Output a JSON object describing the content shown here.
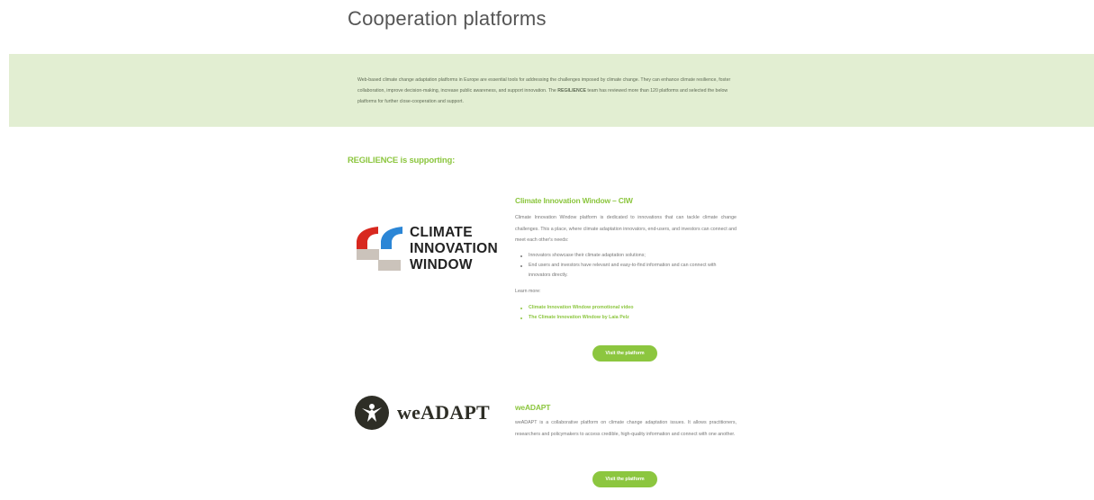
{
  "page": {
    "title": "Cooperation platforms"
  },
  "intro": {
    "text_before": "Web-based climate change adaptation platforms in Europe are essential tools for addressing the challenges imposed by climate change. They can enhance climate resilience, foster collaboration, improve decision-making, increase public awareness, and support innovation. The ",
    "brand": "REGILIENCE",
    "text_after": " team has reviewed more than 120 platforms and selected the below platforms for further close-cooperation and support."
  },
  "supporting_heading": "REGILIENCE is supporting:",
  "platforms": [
    {
      "logo": {
        "lines": [
          "CLIMATE",
          "INNOVATION",
          "WINDOW"
        ],
        "colors": {
          "red": "#d8281f",
          "blue": "#2b86d6",
          "grey": "#cbc3bb"
        }
      },
      "title": "Climate Innovation Window – CIW",
      "description": "Climate Innovation Window platform is dedicated to innovations that can tackle climate change challenges. This a place, where climate adaptation innovators, end-users, and investors can connect and meet each other's needs:",
      "bullets": [
        "Innovators showcase their climate adaptation solutions;",
        "End users and investors have relevant and easy-to-find information and can connect with innovators directly."
      ],
      "learn_more": "Learn more:",
      "links": [
        "Climate Innovation Window promotional video",
        "The Climate Innovation Window by Laia Pelz"
      ],
      "button": "Visit the platform"
    },
    {
      "logo": {
        "text": "weADAPT",
        "icon": "weadapt-figure-icon",
        "color": "#2e2e26"
      },
      "title": "weADAPT",
      "description": "weADAPT is a collaborative platform on climate change adaptation issues. It allows practitioners, researchers and policymakers to access credible, high-quality information and connect with one another.",
      "button": "Visit the platform"
    }
  ],
  "colors": {
    "accent": "#8cc63f",
    "band": "#e2eed2"
  }
}
